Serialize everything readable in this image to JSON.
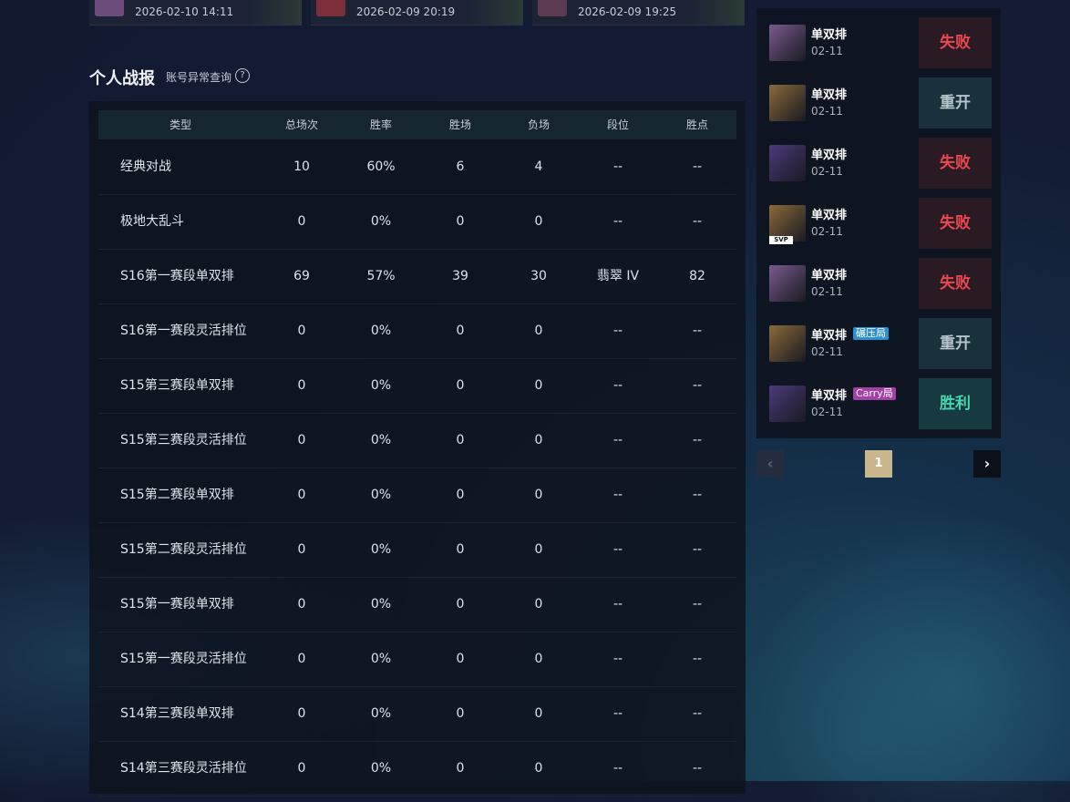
{
  "recent_games": [
    {
      "time": "2026-02-10 14:11"
    },
    {
      "time": "2026-02-09 20:19"
    },
    {
      "time": "2026-02-09 19:25"
    }
  ],
  "section": {
    "title": "个人战报",
    "account_check_label": "账号异常查询",
    "help_icon": "question-circle-icon"
  },
  "stats_table": {
    "headers": [
      "类型",
      "总场次",
      "胜率",
      "胜场",
      "负场",
      "段位",
      "胜点"
    ],
    "rows": [
      {
        "type": "经典对战",
        "total": "10",
        "rate": "60%",
        "wins": "6",
        "losses": "4",
        "rank": "--",
        "lp": "--"
      },
      {
        "type": "极地大乱斗",
        "total": "0",
        "rate": "0%",
        "wins": "0",
        "losses": "0",
        "rank": "--",
        "lp": "--"
      },
      {
        "type": "S16第一赛段单双排",
        "total": "69",
        "rate": "57%",
        "wins": "39",
        "losses": "30",
        "rank": "翡翠 IV",
        "lp": "82"
      },
      {
        "type": "S16第一赛段灵活排位",
        "total": "0",
        "rate": "0%",
        "wins": "0",
        "losses": "0",
        "rank": "--",
        "lp": "--"
      },
      {
        "type": "S15第三赛段单双排",
        "total": "0",
        "rate": "0%",
        "wins": "0",
        "losses": "0",
        "rank": "--",
        "lp": "--"
      },
      {
        "type": "S15第三赛段灵活排位",
        "total": "0",
        "rate": "0%",
        "wins": "0",
        "losses": "0",
        "rank": "--",
        "lp": "--"
      },
      {
        "type": "S15第二赛段单双排",
        "total": "0",
        "rate": "0%",
        "wins": "0",
        "losses": "0",
        "rank": "--",
        "lp": "--"
      },
      {
        "type": "S15第二赛段灵活排位",
        "total": "0",
        "rate": "0%",
        "wins": "0",
        "losses": "0",
        "rank": "--",
        "lp": "--"
      },
      {
        "type": "S15第一赛段单双排",
        "total": "0",
        "rate": "0%",
        "wins": "0",
        "losses": "0",
        "rank": "--",
        "lp": "--"
      },
      {
        "type": "S15第一赛段灵活排位",
        "total": "0",
        "rate": "0%",
        "wins": "0",
        "losses": "0",
        "rank": "--",
        "lp": "--"
      },
      {
        "type": "S14第三赛段单双排",
        "total": "0",
        "rate": "0%",
        "wins": "0",
        "losses": "0",
        "rank": "--",
        "lp": "--"
      },
      {
        "type": "S14第三赛段灵活排位",
        "total": "0",
        "rate": "0%",
        "wins": "0",
        "losses": "0",
        "rank": "--",
        "lp": "--"
      }
    ]
  },
  "match_list": [
    {
      "mode": "单双排",
      "date": "02-11",
      "result": "失败",
      "result_kind": "lose",
      "avatar_color": "#7a5a8c",
      "tag": "",
      "svp": ""
    },
    {
      "mode": "单双排",
      "date": "02-11",
      "result": "重开",
      "result_kind": "remake",
      "avatar_color": "#8a6a3a",
      "tag": "",
      "svp": ""
    },
    {
      "mode": "单双排",
      "date": "02-11",
      "result": "失败",
      "result_kind": "lose",
      "avatar_color": "#4b3a7a",
      "tag": "",
      "svp": ""
    },
    {
      "mode": "单双排",
      "date": "02-11",
      "result": "失败",
      "result_kind": "lose",
      "avatar_color": "#8a6a3a",
      "tag": "",
      "svp": "SVP"
    },
    {
      "mode": "单双排",
      "date": "02-11",
      "result": "失败",
      "result_kind": "lose",
      "avatar_color": "#7a5a8c",
      "tag": "",
      "svp": ""
    },
    {
      "mode": "单双排",
      "date": "02-11",
      "result": "重开",
      "result_kind": "remake",
      "avatar_color": "#8a6a3a",
      "tag": "碾压局",
      "tag_color": "#2b8fd1",
      "svp": ""
    },
    {
      "mode": "单双排",
      "date": "02-11",
      "result": "胜利",
      "result_kind": "win",
      "avatar_color": "#4b3a7a",
      "tag": "Carry局",
      "tag_color": "#a43ea8",
      "svp": ""
    }
  ],
  "pagination": {
    "prev_icon": "chevron-left-icon",
    "current_page": "1",
    "next_icon": "chevron-right-icon"
  }
}
